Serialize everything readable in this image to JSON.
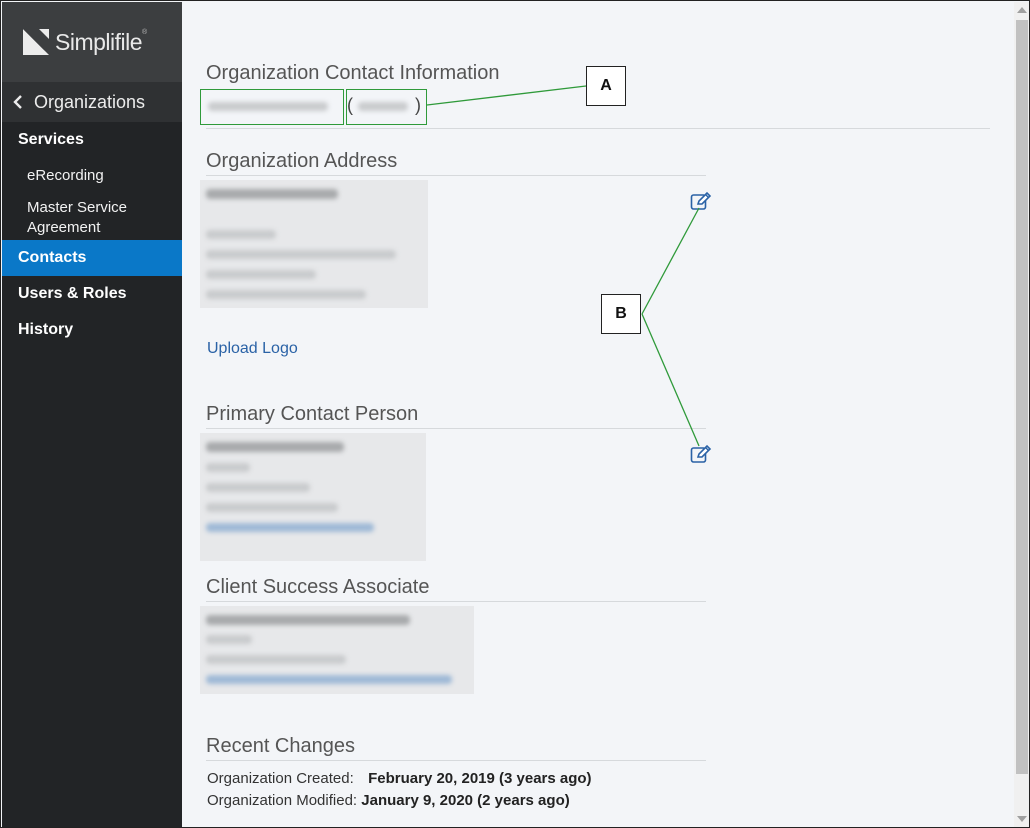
{
  "sidebar": {
    "logo": "Simplifile",
    "back_label": "Organizations",
    "items": [
      {
        "label": "Services"
      },
      {
        "label": "eRecording"
      },
      {
        "label": "Master Service Agreement"
      },
      {
        "label": "Contacts"
      },
      {
        "label": "Users & Roles"
      },
      {
        "label": "History"
      }
    ]
  },
  "main": {
    "org_contact_title": "Organization Contact Information",
    "paren_open": "(",
    "paren_close": ")",
    "org_address_title": "Organization Address",
    "upload_logo": "Upload Logo",
    "primary_contact_title": "Primary Contact Person",
    "csa_title": "Client Success Associate",
    "recent_changes_title": "Recent Changes",
    "created_label": "Organization Created:",
    "created_value": "February 20, 2019 (3 years ago)",
    "modified_label": "Organization Modified:",
    "modified_value": "January 9, 2020 (2 years ago)"
  },
  "callouts": {
    "a": "A",
    "b": "B"
  },
  "colors": {
    "sidebar_bg": "#222426",
    "active_nav": "#0a78c8",
    "link": "#2a62a6",
    "callout_line": "#2f9a3a"
  }
}
